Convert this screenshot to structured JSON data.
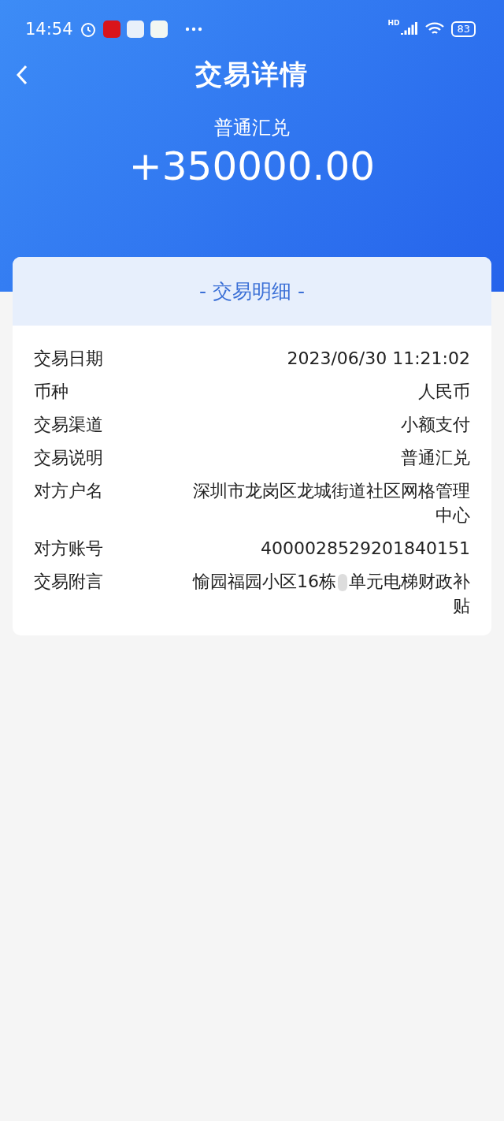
{
  "status_bar": {
    "time": "14:54",
    "battery": "83",
    "network": "HD"
  },
  "header": {
    "title": "交易详情",
    "type": "普通汇兑",
    "amount": "+350000.00"
  },
  "card": {
    "title": "- 交易明细 -",
    "rows": [
      {
        "label": "交易日期",
        "value_parts": [
          "2023/06/30 11:21:02"
        ]
      },
      {
        "label": "币种",
        "value_parts": [
          "人民币"
        ]
      },
      {
        "label": "交易渠道",
        "value_parts": [
          "小额支付"
        ]
      },
      {
        "label": "交易说明",
        "value_parts": [
          "普通汇兑"
        ]
      },
      {
        "label": "对方户名",
        "value_parts": [
          "深圳市龙岗区龙城街道社区网格管理中心"
        ]
      },
      {
        "label": "对方账号",
        "value_parts": [
          "4000028529201840151"
        ]
      },
      {
        "label": "交易附言",
        "value_parts": [
          "愉园福园小区16栋",
          "单元电梯财政补贴"
        ]
      }
    ]
  }
}
